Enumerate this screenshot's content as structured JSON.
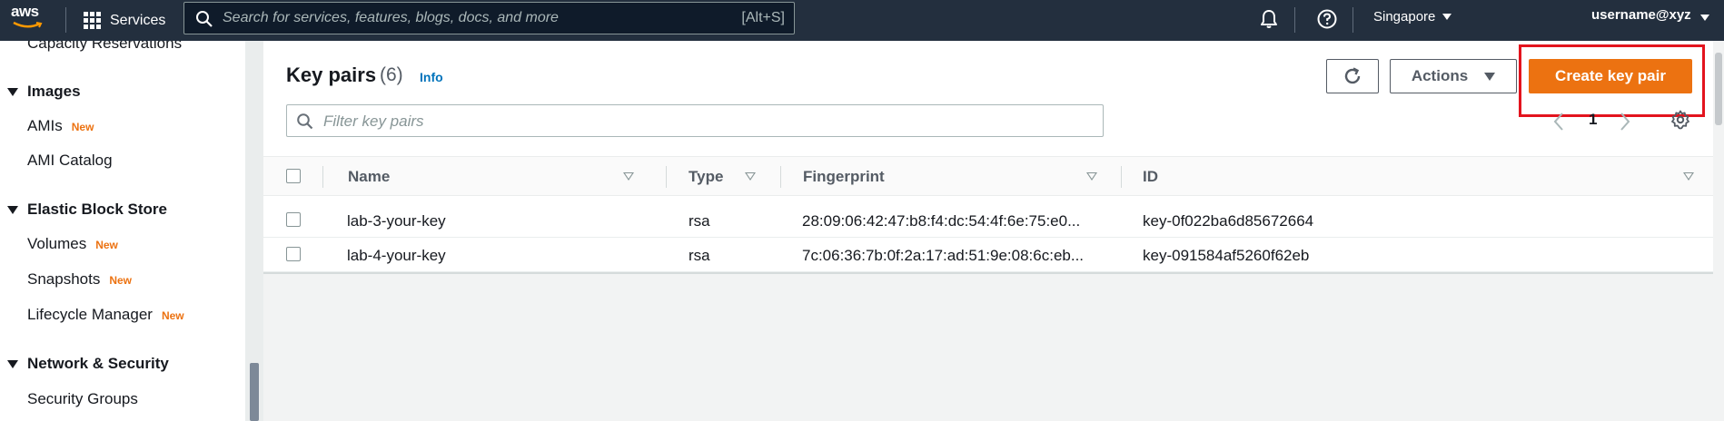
{
  "topnav": {
    "logo_text": "aws",
    "services_label": "Services",
    "search_placeholder": "Search for services, features, blogs, docs, and more",
    "search_shortcut": "[Alt+S]",
    "region": "Singapore",
    "user": "username@xyz"
  },
  "sidebar": {
    "top_item": "Capacity Reservations",
    "images_section": "Images",
    "amis": "AMIs",
    "ami_catalog": "AMI Catalog",
    "ebs_section": "Elastic Block Store",
    "volumes": "Volumes",
    "snapshots": "Snapshots",
    "lifecycle_manager": "Lifecycle Manager",
    "network_section": "Network & Security",
    "security_groups": "Security Groups",
    "new_badge": "New"
  },
  "panel": {
    "title": "Key pairs",
    "count": "(6)",
    "info": "Info",
    "actions_label": "Actions",
    "create_label": "Create key pair",
    "filter_placeholder": "Filter key pairs",
    "page_number": "1"
  },
  "table": {
    "columns": [
      "Name",
      "Type",
      "Fingerprint",
      "ID"
    ],
    "rows": [
      {
        "name": "lab-3-your-key",
        "type": "rsa",
        "fingerprint": "28:09:06:42:47:b8:f4:dc:54:4f:6e:75:e0...",
        "id": "key-0f022ba6d85672664"
      },
      {
        "name": "lab-4-your-key",
        "type": "rsa",
        "fingerprint": "7c:06:36:7b:0f:2a:17:ad:51:9e:08:6c:eb...",
        "id": "key-091584af5260f62eb"
      }
    ]
  },
  "colors": {
    "nav_bg": "#232f3e",
    "accent_orange": "#ec7211",
    "link_blue": "#0073bb",
    "highlight_red": "#e3141e"
  }
}
